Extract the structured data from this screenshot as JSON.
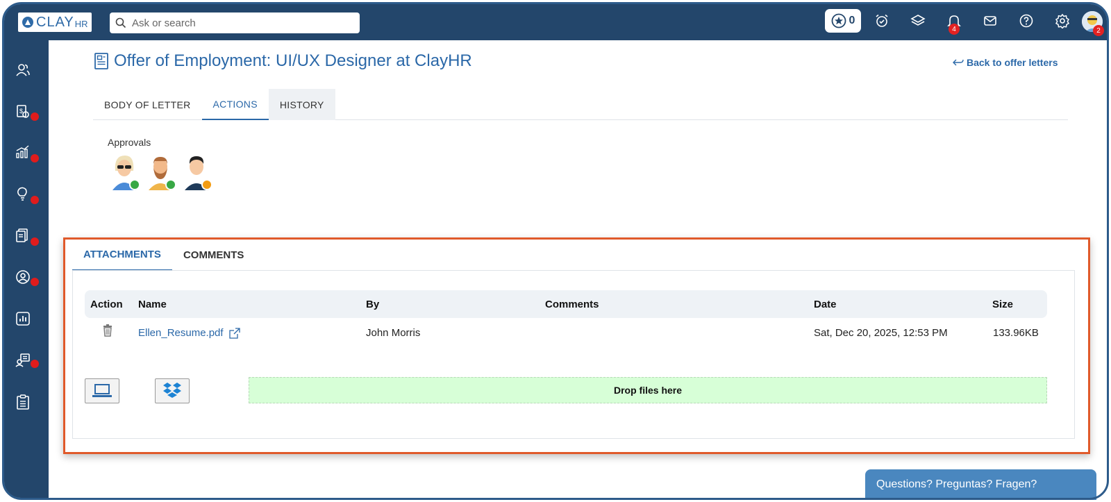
{
  "app": {
    "logo_text": "CLAY",
    "logo_suffix": "HR"
  },
  "search": {
    "placeholder": "Ask or search"
  },
  "topbar": {
    "star_count": "0",
    "notifications_count": "4",
    "avatar_badge_count": "2",
    "icons": [
      "star-icon",
      "alarm-clock-icon",
      "layers-icon",
      "bell-icon",
      "mail-icon",
      "help-icon",
      "gear-icon"
    ]
  },
  "sidebar": {
    "items": [
      {
        "icon": "people-icon",
        "dot": false
      },
      {
        "icon": "payroll-icon",
        "dot": true
      },
      {
        "icon": "growth-chart-icon",
        "dot": true
      },
      {
        "icon": "lightbulb-icon",
        "dot": true
      },
      {
        "icon": "documents-icon",
        "dot": true
      },
      {
        "icon": "user-circle-icon",
        "dot": true
      },
      {
        "icon": "report-icon",
        "dot": false
      },
      {
        "icon": "onboarding-icon",
        "dot": true
      },
      {
        "icon": "checklist-icon",
        "dot": false
      }
    ]
  },
  "page": {
    "title": "Offer of Employment: UI/UX Designer at ClayHR",
    "back_link": "Back to offer letters"
  },
  "tabs": [
    {
      "label": "BODY OF LETTER",
      "active": false
    },
    {
      "label": "ACTIONS",
      "active": true
    },
    {
      "label": "HISTORY",
      "active": false
    }
  ],
  "approvals": {
    "label": "Approvals",
    "approvers": [
      {
        "avatar": "woman-sunglasses-avatar",
        "status": "approved"
      },
      {
        "avatar": "bearded-man-avatar",
        "status": "approved"
      },
      {
        "avatar": "man-dark-hair-avatar",
        "status": "pending"
      }
    ]
  },
  "attachments_panel": {
    "tabs": [
      {
        "label": "ATTACHMENTS",
        "active": true
      },
      {
        "label": "COMMENTS",
        "active": false
      }
    ],
    "columns": [
      "Action",
      "Name",
      "By",
      "Comments",
      "Date",
      "Size"
    ],
    "rows": [
      {
        "name": "Ellen_Resume.pdf",
        "by": "John Morris",
        "comments": "",
        "date": "Sat, Dec 20, 2025, 12:53 PM",
        "size": "133.96KB"
      }
    ],
    "dropzone_label": "Drop files here"
  },
  "help": {
    "label": "Questions? Preguntas? Fragen?"
  },
  "colors": {
    "topbar": "#23466b",
    "accent": "#2b68a8",
    "highlight_border": "#e05a2b",
    "badge_red": "#e32222",
    "dropzone": "#d7ffd7"
  }
}
